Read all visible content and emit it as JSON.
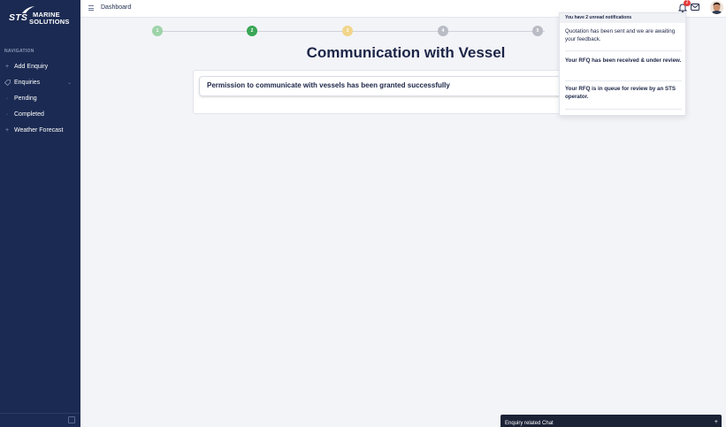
{
  "brand": {
    "line0": "STS",
    "line1": "MARINE",
    "line2": "SOLUTIONS"
  },
  "sidebar": {
    "heading": "NAVIGATION",
    "items": [
      {
        "label": "Add Enquiry",
        "icon": "plus-icon"
      },
      {
        "label": "Enquiries",
        "icon": "tag-icon"
      },
      {
        "label": "Pending",
        "icon": "dot-icon"
      },
      {
        "label": "Completed",
        "icon": "dot-icon"
      },
      {
        "label": "Weather Forecast",
        "icon": "plus-icon"
      }
    ]
  },
  "topbar": {
    "breadcrumb": "Dashboard",
    "badge_count": "2"
  },
  "stepper": {
    "steps": [
      {
        "label": "1",
        "color": "#9ed3a9"
      },
      {
        "label": "2",
        "color": "#3aa655"
      },
      {
        "label": "3",
        "color": "#f2d58a"
      },
      {
        "label": "4",
        "color": "#b9bcc4"
      },
      {
        "label": "5",
        "color": "#b9bcc4"
      }
    ]
  },
  "main": {
    "title": "Communication with Vessel",
    "message": "Permission to communicate with vessels has been granted successfully"
  },
  "notifications": {
    "header": "You have 2 unread notifications",
    "items": [
      {
        "text": "Quotation has been sent and we are awaiting your feedback."
      },
      {
        "text": "Your RFQ has been received & under review."
      },
      {
        "text": "Your RFQ is in queue for review by an STS operator."
      }
    ]
  },
  "chat": {
    "label": "Enquiry related Chat",
    "toggle": "+"
  }
}
